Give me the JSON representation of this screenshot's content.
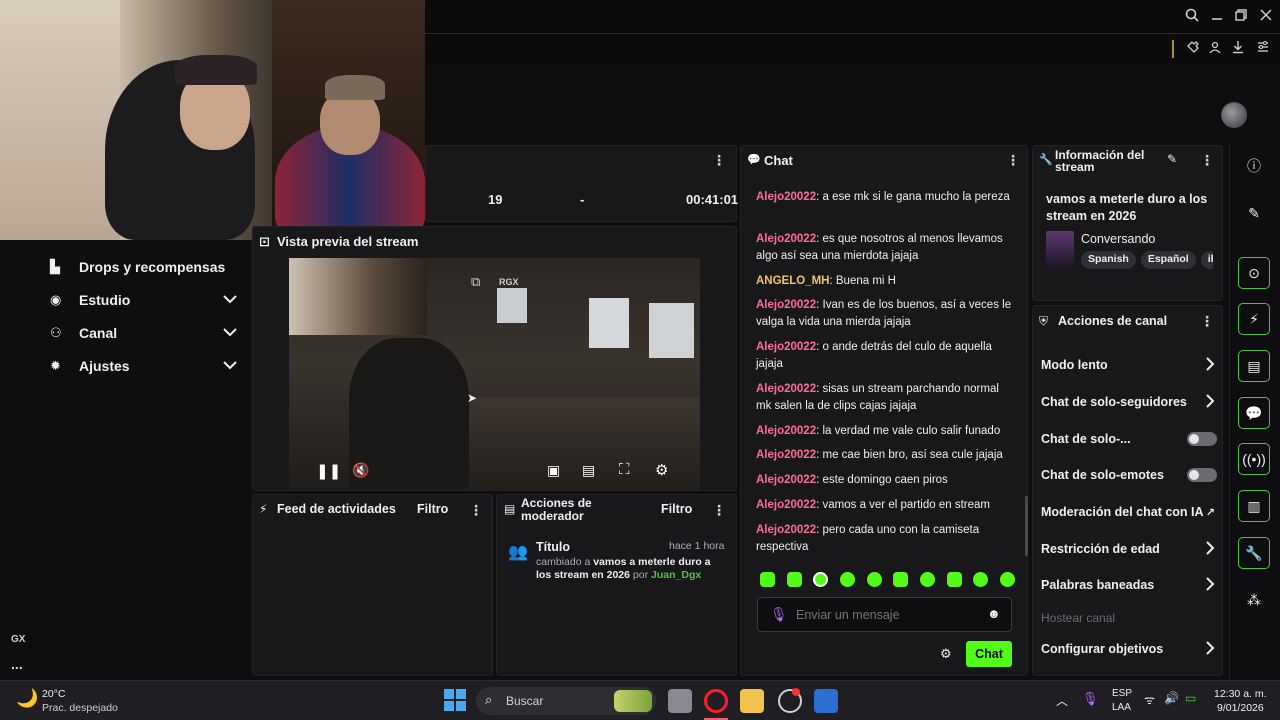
{
  "topbar": {
    "icons": [
      "search-icon",
      "minimize-icon",
      "restore-icon",
      "close-icon"
    ],
    "toolbar_icons": [
      "extensions-icon",
      "account-icon",
      "downloads-icon",
      "settings-icon"
    ]
  },
  "sidebar": {
    "items": [
      {
        "label": "Drops y recompensas",
        "icon": "drops-icon",
        "chevron": false
      },
      {
        "label": "Estudio",
        "icon": "studio-icon",
        "chevron": true
      },
      {
        "label": "Canal",
        "icon": "channel-icon",
        "chevron": true
      },
      {
        "label": "Ajustes",
        "icon": "settings-icon",
        "chevron": true
      }
    ],
    "gx_label": "GX",
    "more_label": "..."
  },
  "stats": {
    "viewers": "19",
    "separator": "-",
    "uptime": "00:41:01"
  },
  "preview": {
    "title": "Vista previa del stream",
    "overlay_label": "RGX"
  },
  "activity_feed": {
    "title": "Feed de actividades",
    "filter": "Filtro"
  },
  "mod_actions": {
    "title": "Acciones de moderador",
    "filter": "Filtro",
    "entry": {
      "title": "Título",
      "time": "hace 1 hora",
      "changed_to": "cambiado a",
      "value": "vamos a meterle duro a los stream en 2026",
      "by": "por",
      "user": "Juan_Dgx"
    }
  },
  "chat": {
    "title": "Chat",
    "messages": [
      {
        "user": "Alejo20022",
        "text": ": a ese mk si le gana mucho la pereza"
      },
      {
        "user": "Alejo20022",
        "text": ": es que nosotros al menos llevamos algo así sea una mierdota jajaja"
      },
      {
        "user": "ANGELO_MH",
        "text": ": Buena mi H"
      },
      {
        "user": "Alejo20022",
        "text": ": Ivan es de los buenos, así a veces le valga la vida una mierda jajaja"
      },
      {
        "user": "Alejo20022",
        "text": ": o ande detrás del culo de aquella jajaja"
      },
      {
        "user": "Alejo20022",
        "text": ": sisas un stream parchando normal mk salen la de clips cajas jajaja"
      },
      {
        "user": "Alejo20022",
        "text": ": la verdad me vale culo salir funado"
      },
      {
        "user": "Alejo20022",
        "text": ": me cae bien bro, así sea cule jajaja"
      },
      {
        "user": "Alejo20022",
        "text": ": este domingo caen piros"
      },
      {
        "user": "Alejo20022",
        "text": ": vamos a ver el partido en stream"
      },
      {
        "user": "Alejo20022",
        "text": ": pero cada uno con la camiseta respectiva"
      }
    ],
    "input_placeholder": "Enviar un mensaje",
    "send_label": "Chat"
  },
  "stream_info": {
    "title": "Información del stream",
    "stream_title": "vamos a meterle duro a los stream en 2026",
    "category": "Conversando",
    "tags": [
      "Spanish",
      "Español",
      "ib"
    ]
  },
  "channel_actions": {
    "title": "Acciones de canal",
    "items": [
      {
        "label": "Modo lento",
        "control": "chevron"
      },
      {
        "label": "Chat de solo-seguidores",
        "control": "chevron"
      },
      {
        "label": "Chat de solo-...",
        "control": "toggle"
      },
      {
        "label": "Chat de solo-emotes",
        "control": "toggle"
      },
      {
        "label": "Moderación del chat con IA",
        "control": "external"
      },
      {
        "label": "Restricción de edad",
        "control": "chevron"
      },
      {
        "label": "Palabras baneadas",
        "control": "chevron"
      },
      {
        "label": "Hostear canal",
        "control": "disabled"
      },
      {
        "label": "Configurar objetivos",
        "control": "chevron"
      }
    ]
  },
  "taskbar": {
    "weather_temp": "20°C",
    "weather_desc": "Prac. despejado",
    "search_label": "Buscar",
    "lang_top": "ESP",
    "lang_bottom": "LAA",
    "time": "12:30 a. m.",
    "date": "9/01/2026"
  },
  "colors": {
    "accent": "#53fc18",
    "username": "#ff6b9a",
    "panel": "#18181b"
  }
}
